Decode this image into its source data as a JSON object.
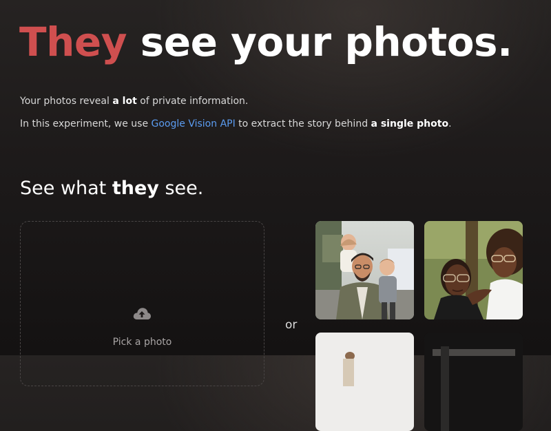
{
  "hero": {
    "title_highlight": "They",
    "title_rest": "see your photos."
  },
  "intro": {
    "line1_before": "Your photos reveal ",
    "line1_bold": "a lot",
    "line1_after": " of private information.",
    "line2_before": "In this experiment, we use ",
    "line2_link": "Google Vision API",
    "line2_middle": " to extract the story behind ",
    "line2_bold": "a single photo",
    "line2_after": "."
  },
  "section": {
    "before": "See what ",
    "bold": "they",
    "after": " see."
  },
  "upload": {
    "icon": "cloud-upload-icon",
    "label": "Pick a photo"
  },
  "separator": "or",
  "colors": {
    "accent_red": "#cf4f4f",
    "link_blue": "#5b9cf1",
    "background": "#1d1a1a"
  }
}
